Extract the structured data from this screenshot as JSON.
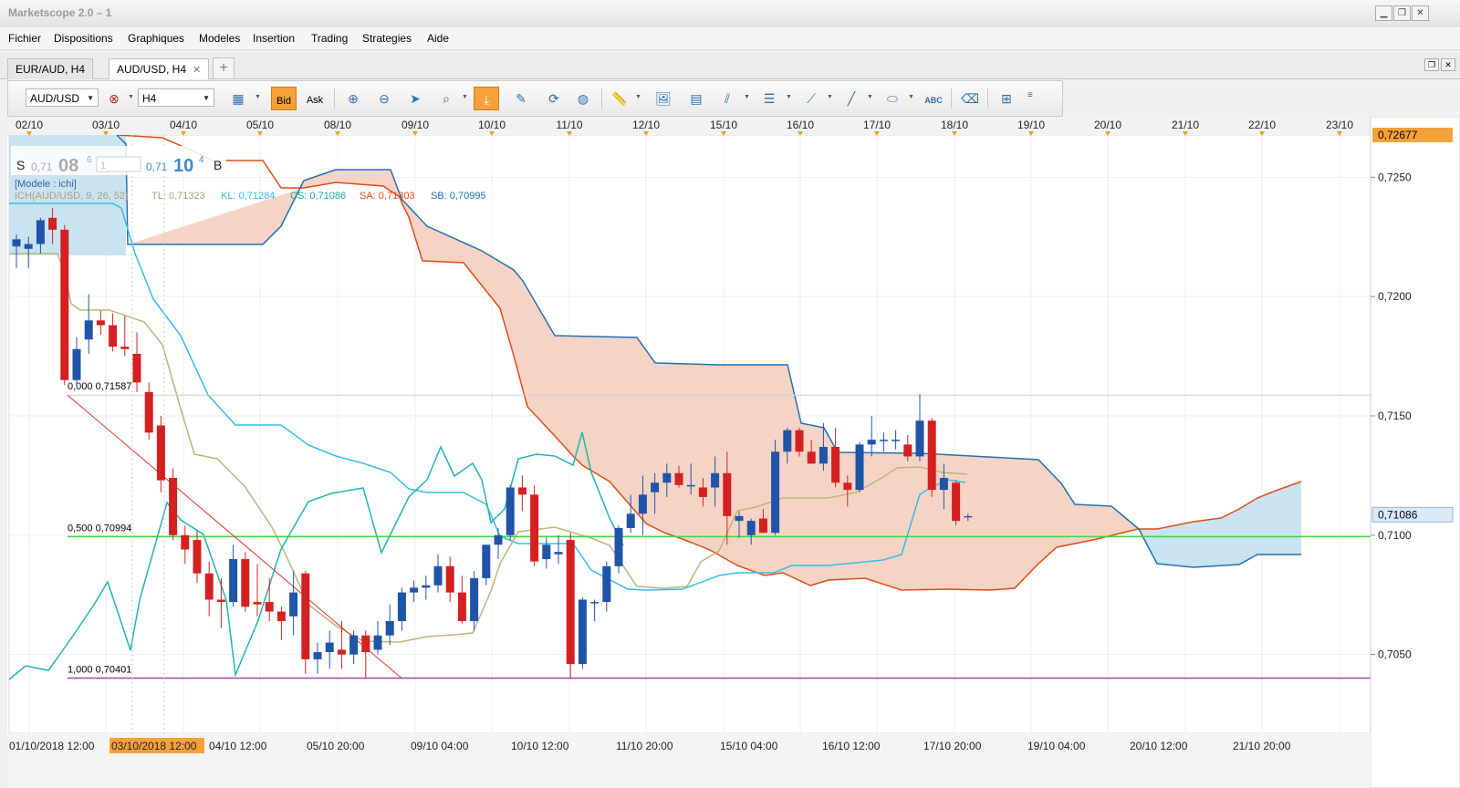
{
  "window": {
    "title": "Marketscope 2.0 – 1"
  },
  "menu": [
    "Fichier",
    "Dispositions",
    "Graphiques",
    "Modeles",
    "Insertion",
    "Trading",
    "Strategies",
    "Aide"
  ],
  "tabs": [
    {
      "label": "EUR/AUD, H4",
      "active": false
    },
    {
      "label": "AUD/USD, H4",
      "active": true
    }
  ],
  "toolbar": {
    "symbol": "AUD/USD",
    "timeframe": "H4",
    "bid_label": "Bid",
    "ask_label": "Ask",
    "bid_selected": true
  },
  "quote": {
    "sell_label": "S",
    "sell_prefix": "0,71",
    "sell_big": "08",
    "sell_sup": "6",
    "amount": "1",
    "buy_prefix": "0,71",
    "buy_big": "10",
    "buy_sup": "4",
    "buy_label": "B"
  },
  "legend": {
    "model": "[Modele : ichi]",
    "ich_label": "ICH(AUD/USD, 9, 26, 52)",
    "tl": "TL: 0,71323",
    "kl": "KL: 0,71284",
    "cs": "CS: 0,71086",
    "sa": "SA: 0,71303",
    "sb": "SB: 0,70995"
  },
  "price_axis": {
    "labels": [
      "0,7250",
      "0,7200",
      "0,7150",
      "0,7100",
      "0,7050"
    ],
    "top_badge": "0,72677",
    "current_badge": "0,71086"
  },
  "date_axis_top": [
    "02/10",
    "03/10",
    "04/10",
    "05/10",
    "08/10",
    "09/10",
    "10/10",
    "11/10",
    "12/10",
    "15/10",
    "16/10",
    "17/10",
    "18/10",
    "19/10",
    "20/10",
    "21/10",
    "22/10",
    "23/10"
  ],
  "time_axis_bottom": [
    "01/10/2018 12:00",
    "03/10/2018 12:00",
    "04/10 12:00",
    "05/10 20:00",
    "09/10 04:00",
    "10/10 12:00",
    "11/10 20:00",
    "15/10 04:00",
    "16/10 12:00",
    "17/10 20:00",
    "19/10 04:00",
    "20/10 12:00",
    "21/10 20:00"
  ],
  "fibonacci": [
    {
      "label": "0,000 0,71587",
      "price": 0.71587
    },
    {
      "label": "0,500 0,70994",
      "price": 0.70994
    },
    {
      "label": "1,000 0,70401",
      "price": 0.70401
    }
  ],
  "colors": {
    "bull": "#2054a8",
    "bear": "#d42020",
    "tenkan": "#c0b37a",
    "kijun": "#33bde8",
    "chikou": "#1fb5b0",
    "senkou_a": "#e04b14",
    "senkou_b": "#2170b3",
    "cloud_bear": "#f5d4c6",
    "cloud_bull": "#c9e3f0",
    "fib_mid": "#38d838",
    "fib_low": "#b040b0",
    "accent": "#f5a13a"
  },
  "chart_data": {
    "type": "candlestick",
    "symbol": "AUD/USD",
    "timeframe": "H4",
    "ylim": [
      0.7017,
      0.72677
    ],
    "candles": [
      {
        "o": 0.7221,
        "h": 0.7226,
        "l": 0.7212,
        "c": 0.7224
      },
      {
        "o": 0.722,
        "h": 0.7225,
        "l": 0.7212,
        "c": 0.7222
      },
      {
        "o": 0.7222,
        "h": 0.7233,
        "l": 0.7218,
        "c": 0.7232
      },
      {
        "o": 0.7233,
        "h": 0.7237,
        "l": 0.7222,
        "c": 0.7228
      },
      {
        "o": 0.7228,
        "h": 0.723,
        "l": 0.7163,
        "c": 0.7165
      },
      {
        "o": 0.7165,
        "h": 0.7183,
        "l": 0.7162,
        "c": 0.7178
      },
      {
        "o": 0.7182,
        "h": 0.7201,
        "l": 0.7176,
        "c": 0.719
      },
      {
        "o": 0.719,
        "h": 0.7194,
        "l": 0.7184,
        "c": 0.7188
      },
      {
        "o": 0.7188,
        "h": 0.7193,
        "l": 0.7177,
        "c": 0.7179
      },
      {
        "o": 0.7179,
        "h": 0.7192,
        "l": 0.7175,
        "c": 0.7178
      },
      {
        "o": 0.7176,
        "h": 0.7185,
        "l": 0.716,
        "c": 0.7164
      },
      {
        "o": 0.716,
        "h": 0.7164,
        "l": 0.714,
        "c": 0.7143
      },
      {
        "o": 0.7146,
        "h": 0.715,
        "l": 0.7118,
        "c": 0.7123
      },
      {
        "o": 0.7124,
        "h": 0.7128,
        "l": 0.7098,
        "c": 0.71
      },
      {
        "o": 0.71,
        "h": 0.7104,
        "l": 0.7088,
        "c": 0.7094
      },
      {
        "o": 0.7098,
        "h": 0.7102,
        "l": 0.708,
        "c": 0.7084
      },
      {
        "o": 0.7084,
        "h": 0.7089,
        "l": 0.7066,
        "c": 0.7073
      },
      {
        "o": 0.7073,
        "h": 0.7082,
        "l": 0.7061,
        "c": 0.7072
      },
      {
        "o": 0.7072,
        "h": 0.7096,
        "l": 0.707,
        "c": 0.709
      },
      {
        "o": 0.709,
        "h": 0.7093,
        "l": 0.7068,
        "c": 0.707
      },
      {
        "o": 0.7072,
        "h": 0.7088,
        "l": 0.7066,
        "c": 0.7071
      },
      {
        "o": 0.7072,
        "h": 0.7082,
        "l": 0.7064,
        "c": 0.7068
      },
      {
        "o": 0.7068,
        "h": 0.707,
        "l": 0.7056,
        "c": 0.7064
      },
      {
        "o": 0.7066,
        "h": 0.7085,
        "l": 0.7058,
        "c": 0.7076
      },
      {
        "o": 0.7084,
        "h": 0.7085,
        "l": 0.7042,
        "c": 0.7048
      },
      {
        "o": 0.7048,
        "h": 0.7055,
        "l": 0.7042,
        "c": 0.7051
      },
      {
        "o": 0.7051,
        "h": 0.706,
        "l": 0.7044,
        "c": 0.7055
      },
      {
        "o": 0.7052,
        "h": 0.7064,
        "l": 0.7044,
        "c": 0.705
      },
      {
        "o": 0.705,
        "h": 0.706,
        "l": 0.7046,
        "c": 0.7058
      },
      {
        "o": 0.7058,
        "h": 0.706,
        "l": 0.704,
        "c": 0.7051
      },
      {
        "o": 0.7052,
        "h": 0.7064,
        "l": 0.705,
        "c": 0.7058
      },
      {
        "o": 0.7058,
        "h": 0.7071,
        "l": 0.7054,
        "c": 0.7064
      },
      {
        "o": 0.7064,
        "h": 0.7078,
        "l": 0.706,
        "c": 0.7076
      },
      {
        "o": 0.7076,
        "h": 0.7081,
        "l": 0.7072,
        "c": 0.7078
      },
      {
        "o": 0.7078,
        "h": 0.7083,
        "l": 0.7073,
        "c": 0.7079
      },
      {
        "o": 0.7079,
        "h": 0.7092,
        "l": 0.7076,
        "c": 0.7087
      },
      {
        "o": 0.7087,
        "h": 0.7091,
        "l": 0.7072,
        "c": 0.7076
      },
      {
        "o": 0.7076,
        "h": 0.7083,
        "l": 0.7063,
        "c": 0.7064
      },
      {
        "o": 0.7064,
        "h": 0.7085,
        "l": 0.706,
        "c": 0.7082
      },
      {
        "o": 0.7082,
        "h": 0.7096,
        "l": 0.7079,
        "c": 0.7096
      },
      {
        "o": 0.7096,
        "h": 0.7103,
        "l": 0.709,
        "c": 0.71
      },
      {
        "o": 0.71,
        "h": 0.7121,
        "l": 0.7098,
        "c": 0.712
      },
      {
        "o": 0.712,
        "h": 0.7125,
        "l": 0.711,
        "c": 0.7117
      },
      {
        "o": 0.7117,
        "h": 0.7121,
        "l": 0.7087,
        "c": 0.7089
      },
      {
        "o": 0.709,
        "h": 0.7099,
        "l": 0.7086,
        "c": 0.7096
      },
      {
        "o": 0.7092,
        "h": 0.71,
        "l": 0.7088,
        "c": 0.7093
      },
      {
        "o": 0.7098,
        "h": 0.7101,
        "l": 0.704,
        "c": 0.7046
      },
      {
        "o": 0.7046,
        "h": 0.7074,
        "l": 0.7044,
        "c": 0.7073
      },
      {
        "o": 0.7072,
        "h": 0.7073,
        "l": 0.7064,
        "c": 0.7072
      },
      {
        "o": 0.7072,
        "h": 0.7089,
        "l": 0.7068,
        "c": 0.7087
      },
      {
        "o": 0.7087,
        "h": 0.7104,
        "l": 0.7084,
        "c": 0.7103
      },
      {
        "o": 0.7103,
        "h": 0.7117,
        "l": 0.7101,
        "c": 0.7109
      },
      {
        "o": 0.7109,
        "h": 0.7125,
        "l": 0.71,
        "c": 0.7117
      },
      {
        "o": 0.7118,
        "h": 0.7126,
        "l": 0.7109,
        "c": 0.7122
      },
      {
        "o": 0.7122,
        "h": 0.713,
        "l": 0.7116,
        "c": 0.7126
      },
      {
        "o": 0.7126,
        "h": 0.7129,
        "l": 0.712,
        "c": 0.7121
      },
      {
        "o": 0.7121,
        "h": 0.713,
        "l": 0.7117,
        "c": 0.7121
      },
      {
        "o": 0.712,
        "h": 0.7124,
        "l": 0.7112,
        "c": 0.7116
      },
      {
        "o": 0.712,
        "h": 0.7133,
        "l": 0.7112,
        "c": 0.7126
      },
      {
        "o": 0.7126,
        "h": 0.7135,
        "l": 0.7096,
        "c": 0.7108
      },
      {
        "o": 0.7106,
        "h": 0.711,
        "l": 0.7099,
        "c": 0.7108
      },
      {
        "o": 0.71,
        "h": 0.7107,
        "l": 0.7096,
        "c": 0.7106
      },
      {
        "o": 0.7107,
        "h": 0.7111,
        "l": 0.7101,
        "c": 0.7101
      },
      {
        "o": 0.7101,
        "h": 0.714,
        "l": 0.71,
        "c": 0.7135
      },
      {
        "o": 0.7135,
        "h": 0.7145,
        "l": 0.713,
        "c": 0.7144
      },
      {
        "o": 0.7144,
        "h": 0.7145,
        "l": 0.7133,
        "c": 0.7135
      },
      {
        "o": 0.7135,
        "h": 0.714,
        "l": 0.713,
        "c": 0.713
      },
      {
        "o": 0.713,
        "h": 0.7147,
        "l": 0.7127,
        "c": 0.7137
      },
      {
        "o": 0.7137,
        "h": 0.7145,
        "l": 0.712,
        "c": 0.7122
      },
      {
        "o": 0.7122,
        "h": 0.7125,
        "l": 0.7112,
        "c": 0.7119
      },
      {
        "o": 0.7119,
        "h": 0.7139,
        "l": 0.7118,
        "c": 0.7138
      },
      {
        "o": 0.7138,
        "h": 0.715,
        "l": 0.7133,
        "c": 0.714
      },
      {
        "o": 0.714,
        "h": 0.7143,
        "l": 0.7135,
        "c": 0.714
      },
      {
        "o": 0.714,
        "h": 0.7144,
        "l": 0.7136,
        "c": 0.714
      },
      {
        "o": 0.7138,
        "h": 0.7142,
        "l": 0.7131,
        "c": 0.7133
      },
      {
        "o": 0.7133,
        "h": 0.7159,
        "l": 0.7131,
        "c": 0.7148
      },
      {
        "o": 0.7148,
        "h": 0.7149,
        "l": 0.7116,
        "c": 0.7119
      },
      {
        "o": 0.7119,
        "h": 0.713,
        "l": 0.7111,
        "c": 0.7124
      },
      {
        "o": 0.7122,
        "h": 0.7123,
        "l": 0.7104,
        "c": 0.7106
      },
      {
        "o": 0.7108,
        "h": 0.7109,
        "l": 0.7106,
        "c": 0.7108
      }
    ]
  }
}
